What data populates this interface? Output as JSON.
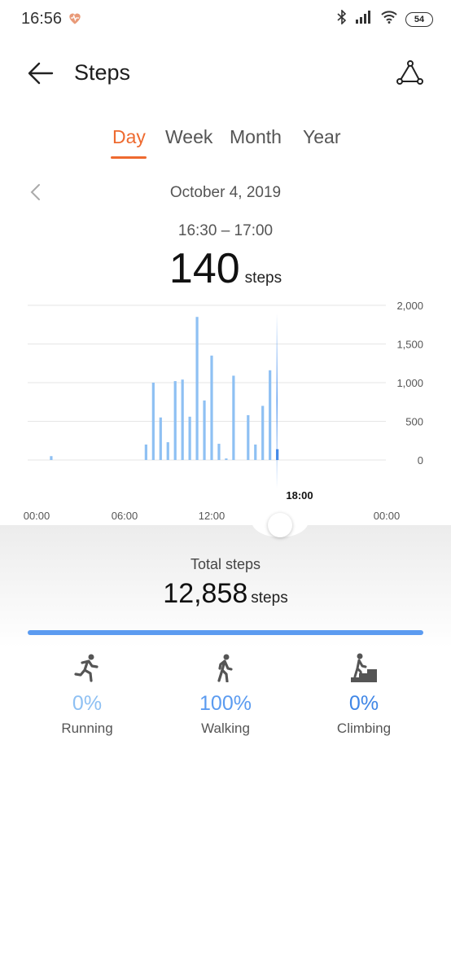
{
  "status": {
    "time": "16:56",
    "battery": "54"
  },
  "header": {
    "title": "Steps"
  },
  "tabs": [
    {
      "label": "Day",
      "active": true
    },
    {
      "label": "Week",
      "active": false
    },
    {
      "label": "Month",
      "active": false
    },
    {
      "label": "Year",
      "active": false
    }
  ],
  "date": "October 4, 2019",
  "selection": {
    "range": "16:30 – 17:00",
    "steps": "140",
    "unit": "steps"
  },
  "chart_data": {
    "type": "bar",
    "x": [
      "01:00",
      "07:30",
      "08:00",
      "08:30",
      "09:00",
      "09:30",
      "10:00",
      "10:30",
      "11:00",
      "11:30",
      "12:00",
      "12:30",
      "13:00",
      "13:30",
      "14:30",
      "15:00",
      "15:30",
      "16:00",
      "16:30"
    ],
    "values": [
      50,
      200,
      1000,
      550,
      230,
      1020,
      1040,
      560,
      1850,
      770,
      1350,
      210,
      20,
      1090,
      580,
      200,
      700,
      1160,
      140
    ],
    "selected_index": 18,
    "ylim": [
      0,
      2000
    ],
    "yticks": [
      "2,000",
      "1,500",
      "1,000",
      "500",
      "0"
    ],
    "xticks": [
      "00:00",
      "06:00",
      "12:00",
      "00:00"
    ],
    "cursor_label": "18:00",
    "bar_color": "#8ec0f3",
    "selected_color": "#3f86e6"
  },
  "summary": {
    "label": "Total steps",
    "value": "12,858",
    "unit": "steps"
  },
  "activities": [
    {
      "name": "Running",
      "percent": "0%",
      "icon": "running-icon",
      "color": "#8ec0f3"
    },
    {
      "name": "Walking",
      "percent": "100%",
      "icon": "walking-icon",
      "color": "#5b9bf0"
    },
    {
      "name": "Climbing",
      "percent": "0%",
      "icon": "climbing-icon",
      "color": "#3f86e6"
    }
  ]
}
